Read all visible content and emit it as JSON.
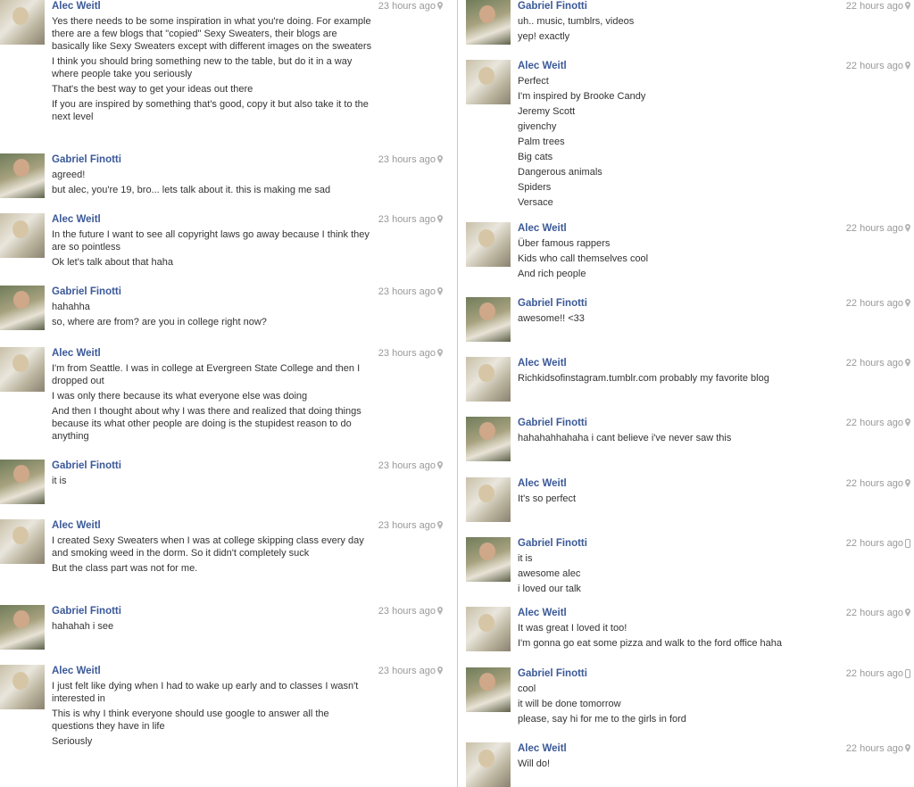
{
  "left": [
    {
      "author": "Alec Weitl",
      "time": "23 hours ago",
      "lines": [
        "Yes there needs to be some inspiration in what you're doing. For example there are a few blogs that \"copied\" Sexy Sweaters, their blogs are basically like Sexy Sweaters except with different images on the sweaters",
        "I think you should bring something new to the table, but do it in a way where people take you seriously",
        "That's the best way to get your ideas out there",
        "If you are inspired by something that's good, copy it but also take it to the next level"
      ]
    },
    {
      "author": "Gabriel Finotti",
      "time": "23 hours ago",
      "lines": [
        "agreed!",
        "but alec, you're 19, bro... lets talk about it. this is making me sad"
      ]
    },
    {
      "author": "Alec Weitl",
      "time": "23 hours ago",
      "lines": [
        "In the future I want to see all copyright laws go away because I think they are so pointless",
        "Ok let's talk about that haha"
      ]
    },
    {
      "author": "Gabriel Finotti",
      "time": "23 hours ago",
      "lines": [
        "hahahha",
        "so, where are from? are you in college right now?"
      ]
    },
    {
      "author": "Alec Weitl",
      "time": "23 hours ago",
      "lines": [
        "I'm from Seattle. I was in college at Evergreen State College and then I dropped out",
        "I was only there because its what everyone else was doing",
        "And then I thought about why I was there and realized that doing things because its what other people are doing is the stupidest reason to do anything"
      ]
    },
    {
      "author": "Gabriel Finotti",
      "time": "23 hours ago",
      "lines": [
        "it is"
      ]
    },
    {
      "author": "Alec Weitl",
      "time": "23 hours ago",
      "lines": [
        "I created Sexy Sweaters when I was at college skipping class every day and smoking weed in the dorm. So it didn't completely suck",
        "But the class part was not for me."
      ]
    },
    {
      "author": "Gabriel Finotti",
      "time": "23 hours ago",
      "lines": [
        "hahahah i see"
      ]
    },
    {
      "author": "Alec Weitl",
      "time": "23 hours ago",
      "lines": [
        "I just felt like dying when I had to wake up early and to classes I wasn't interested in",
        "This is why I think everyone should use google to answer all the questions they have in life",
        "Seriously"
      ]
    }
  ],
  "right": [
    {
      "author": "Gabriel Finotti",
      "time": "22 hours ago",
      "lines": [
        "uh.. music, tumblrs, videos",
        "yep! exactly"
      ]
    },
    {
      "author": "Alec Weitl",
      "time": "22 hours ago",
      "lines": [
        "Perfect",
        "I'm inspired by Brooke Candy",
        "Jeremy Scott",
        "givenchy",
        "Palm trees",
        "Big cats",
        "Dangerous animals",
        "Spiders",
        "Versace"
      ]
    },
    {
      "author": "Alec Weitl",
      "time": "22 hours ago",
      "lines": [
        "Über famous rappers",
        "Kids who call themselves cool",
        "And rich people"
      ]
    },
    {
      "author": "Gabriel Finotti",
      "time": "22 hours ago",
      "lines": [
        "awesome!! <33"
      ]
    },
    {
      "author": "Alec Weitl",
      "time": "22 hours ago",
      "lines": [
        "Richkidsofinstagram.tumblr.com probably my favorite blog"
      ]
    },
    {
      "author": "Gabriel Finotti",
      "time": "22 hours ago",
      "lines": [
        "hahahahhahaha i cant believe i've never saw this"
      ]
    },
    {
      "author": "Alec Weitl",
      "time": "22 hours ago",
      "lines": [
        "It's so perfect"
      ]
    },
    {
      "author": "Gabriel Finotti",
      "time": "22 hours ago",
      "lines": [
        "it is",
        "awesome alec",
        "i loved our talk"
      ]
    },
    {
      "author": "Alec Weitl",
      "time": "22 hours ago",
      "lines": [
        "It was great I loved it too!",
        "I'm gonna go eat some pizza and walk to the ford office haha"
      ]
    },
    {
      "author": "Gabriel Finotti",
      "time": "22 hours ago",
      "lines": [
        "cool",
        "it will be done tomorrow",
        "please, say hi for me to the girls in ford"
      ]
    },
    {
      "author": "Alec Weitl",
      "time": "22 hours ago",
      "lines": [
        "Will do!"
      ]
    }
  ],
  "theme": {
    "name_color": "#3b5998",
    "time_color": "#999999",
    "text_color": "#333333",
    "divider_color": "#c9c9c9"
  }
}
